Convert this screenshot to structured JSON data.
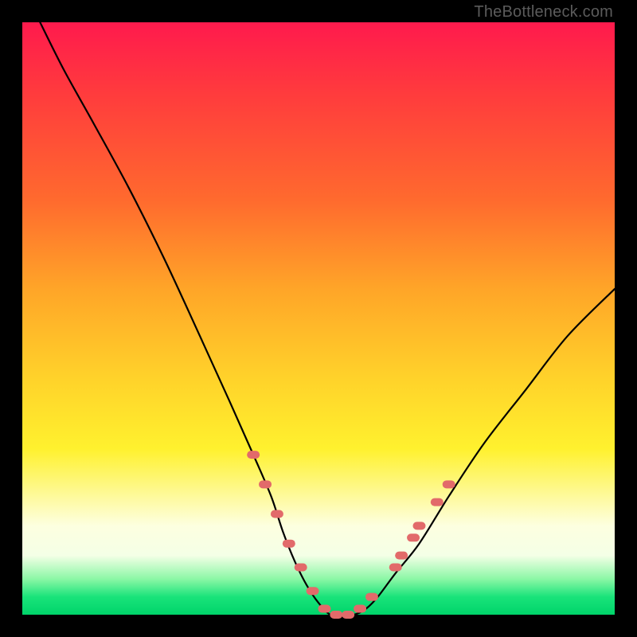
{
  "attribution": "TheBottleneck.com",
  "chart_data": {
    "type": "line",
    "title": "",
    "xlabel": "",
    "ylabel": "",
    "xlim": [
      0,
      100
    ],
    "ylim": [
      0,
      100
    ],
    "series": [
      {
        "name": "bottleneck-curve",
        "x": [
          3,
          7,
          12,
          18,
          24,
          30,
          35,
          39,
          42,
          44,
          46,
          48,
          50,
          52,
          54,
          56,
          58,
          60,
          63,
          67,
          72,
          78,
          85,
          92,
          100
        ],
        "y": [
          100,
          92,
          83,
          72,
          60,
          47,
          36,
          27,
          20,
          14,
          9,
          5,
          2,
          0,
          0,
          0,
          1,
          3,
          7,
          12,
          20,
          29,
          38,
          47,
          55
        ]
      }
    ],
    "markers": {
      "name": "highlight-dots",
      "color": "#e26a6a",
      "points": [
        {
          "x": 39,
          "y": 27
        },
        {
          "x": 41,
          "y": 22
        },
        {
          "x": 43,
          "y": 17
        },
        {
          "x": 45,
          "y": 12
        },
        {
          "x": 47,
          "y": 8
        },
        {
          "x": 49,
          "y": 4
        },
        {
          "x": 51,
          "y": 1
        },
        {
          "x": 53,
          "y": 0
        },
        {
          "x": 55,
          "y": 0
        },
        {
          "x": 57,
          "y": 1
        },
        {
          "x": 59,
          "y": 3
        },
        {
          "x": 63,
          "y": 8
        },
        {
          "x": 64,
          "y": 10
        },
        {
          "x": 66,
          "y": 13
        },
        {
          "x": 67,
          "y": 15
        },
        {
          "x": 70,
          "y": 19
        },
        {
          "x": 72,
          "y": 22
        }
      ]
    }
  }
}
